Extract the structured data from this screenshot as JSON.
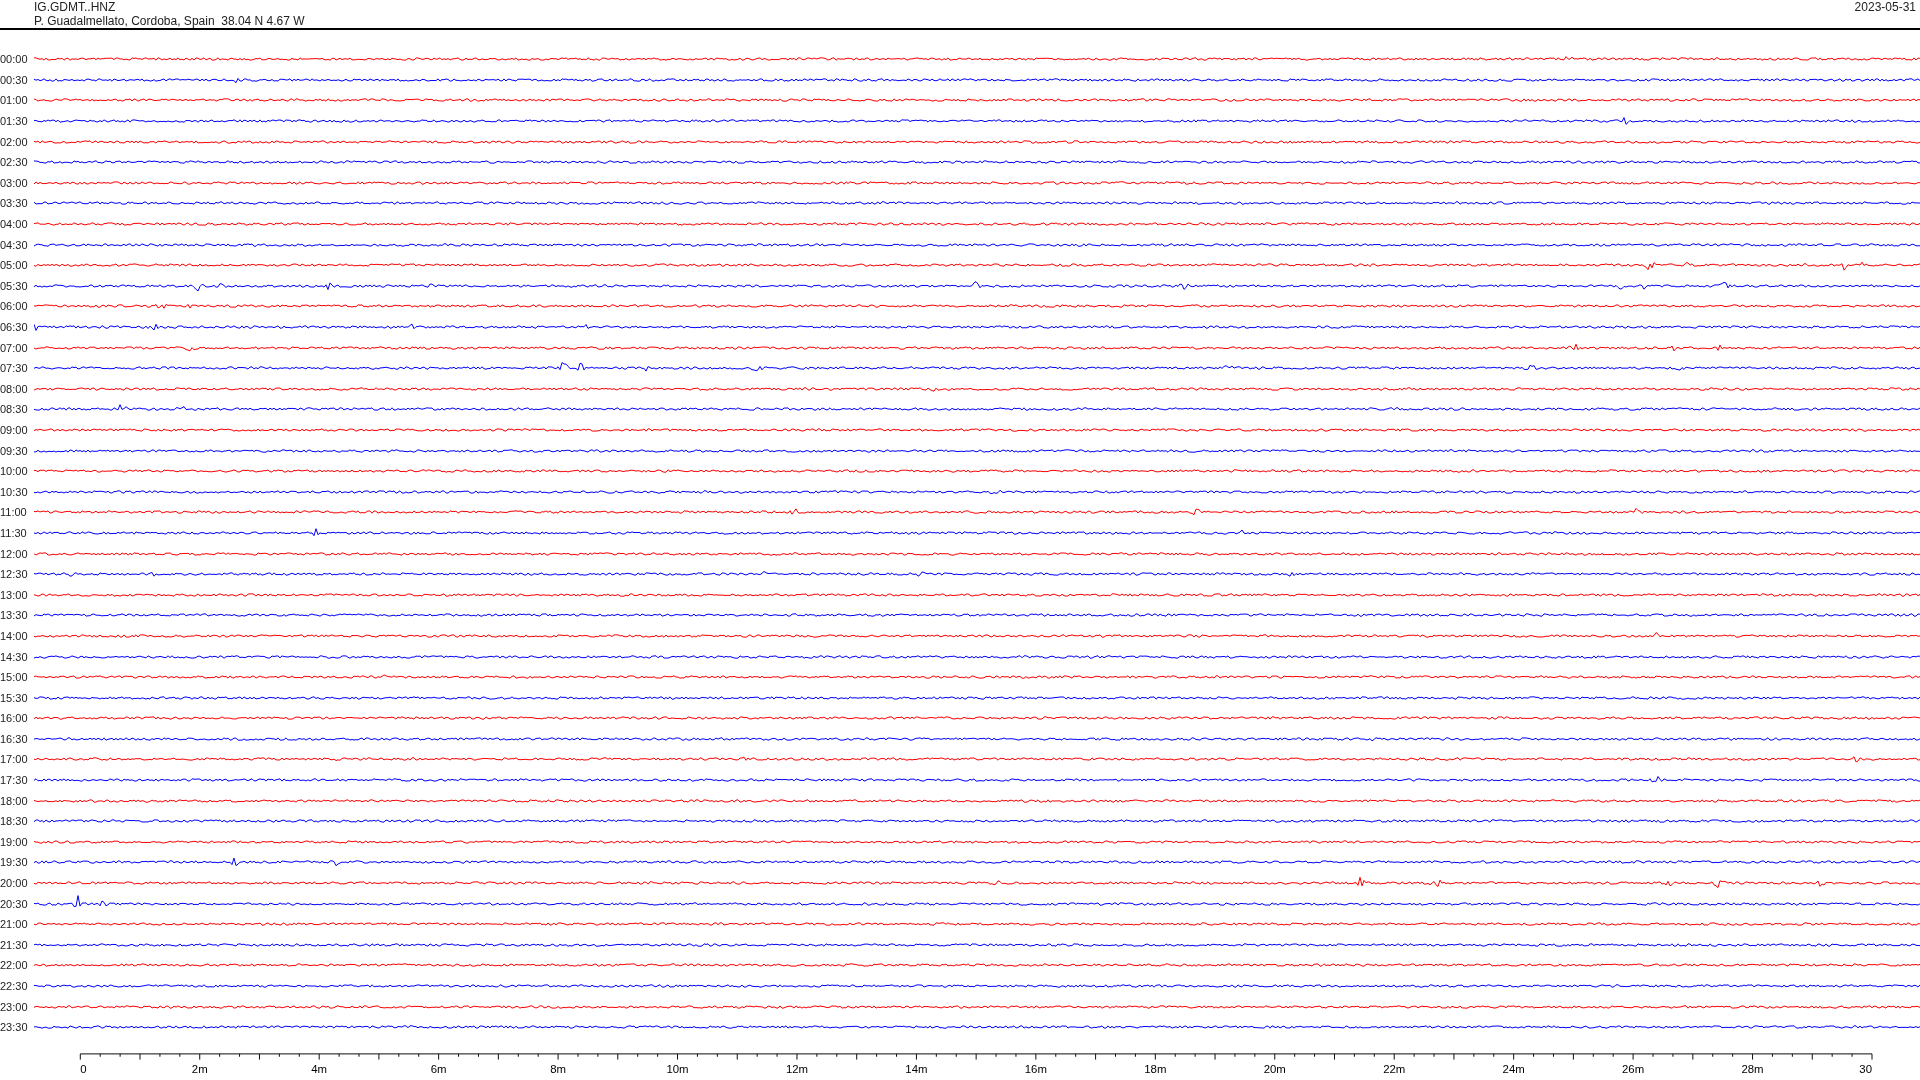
{
  "header": {
    "station": "IG.GDMT..HNZ",
    "location": "P. Guadalmellato, Cordoba, Spain  38.04 N 4.67 W",
    "date": "2023-05-31"
  },
  "traces": [
    {
      "time": "00:00",
      "color": "#ff0000"
    },
    {
      "time": "00:30",
      "color": "#0000ff"
    },
    {
      "time": "01:00",
      "color": "#ff0000"
    },
    {
      "time": "01:30",
      "color": "#0000ff"
    },
    {
      "time": "02:00",
      "color": "#ff0000"
    },
    {
      "time": "02:30",
      "color": "#0000ff"
    },
    {
      "time": "03:00",
      "color": "#ff0000"
    },
    {
      "time": "03:30",
      "color": "#0000ff"
    },
    {
      "time": "04:00",
      "color": "#ff0000"
    },
    {
      "time": "04:30",
      "color": "#0000ff"
    },
    {
      "time": "05:00",
      "color": "#ff0000"
    },
    {
      "time": "05:30",
      "color": "#0000ff"
    },
    {
      "time": "06:00",
      "color": "#ff0000"
    },
    {
      "time": "06:30",
      "color": "#0000ff"
    },
    {
      "time": "07:00",
      "color": "#ff0000"
    },
    {
      "time": "07:30",
      "color": "#0000ff"
    },
    {
      "time": "08:00",
      "color": "#ff0000"
    },
    {
      "time": "08:30",
      "color": "#0000ff"
    },
    {
      "time": "09:00",
      "color": "#ff0000"
    },
    {
      "time": "09:30",
      "color": "#0000ff"
    },
    {
      "time": "10:00",
      "color": "#ff0000"
    },
    {
      "time": "10:30",
      "color": "#0000ff"
    },
    {
      "time": "11:00",
      "color": "#ff0000"
    },
    {
      "time": "11:30",
      "color": "#0000ff"
    },
    {
      "time": "12:00",
      "color": "#ff0000"
    },
    {
      "time": "12:30",
      "color": "#0000ff"
    },
    {
      "time": "13:00",
      "color": "#ff0000"
    },
    {
      "time": "13:30",
      "color": "#0000ff"
    },
    {
      "time": "14:00",
      "color": "#ff0000"
    },
    {
      "time": "14:30",
      "color": "#0000ff"
    },
    {
      "time": "15:00",
      "color": "#ff0000"
    },
    {
      "time": "15:30",
      "color": "#0000ff"
    },
    {
      "time": "16:00",
      "color": "#ff0000"
    },
    {
      "time": "16:30",
      "color": "#0000ff"
    },
    {
      "time": "17:00",
      "color": "#ff0000"
    },
    {
      "time": "17:30",
      "color": "#0000ff"
    },
    {
      "time": "18:00",
      "color": "#ff0000"
    },
    {
      "time": "18:30",
      "color": "#0000ff"
    },
    {
      "time": "19:00",
      "color": "#ff0000"
    },
    {
      "time": "19:30",
      "color": "#0000ff"
    },
    {
      "time": "20:00",
      "color": "#ff0000"
    },
    {
      "time": "20:30",
      "color": "#0000ff"
    },
    {
      "time": "21:00",
      "color": "#ff0000"
    },
    {
      "time": "21:30",
      "color": "#0000ff"
    },
    {
      "time": "22:00",
      "color": "#ff0000"
    },
    {
      "time": "22:30",
      "color": "#0000ff"
    },
    {
      "time": "23:00",
      "color": "#ff0000"
    },
    {
      "time": "23:30",
      "color": "#0000ff"
    }
  ],
  "time_axis": {
    "labels": [
      "0",
      "2m",
      "4m",
      "6m",
      "8m",
      "10m",
      "12m",
      "14m",
      "16m",
      "18m",
      "20m",
      "22m",
      "24m",
      "26m",
      "28m",
      "30"
    ]
  }
}
